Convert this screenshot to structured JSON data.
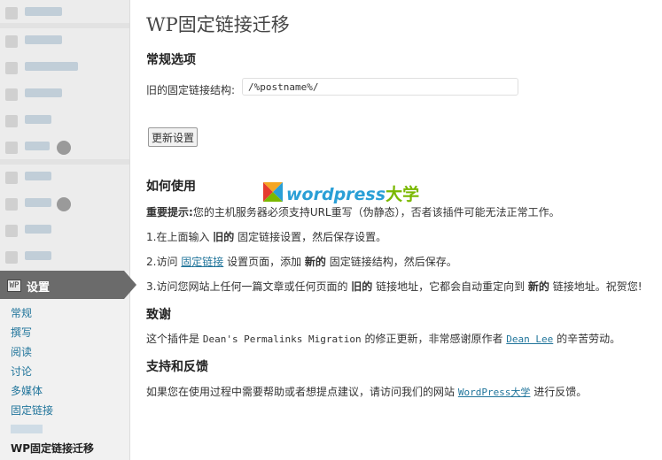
{
  "sidebar": {
    "settings_label": "设置",
    "settings_icon_text": "WP",
    "submenu": [
      "常规",
      "撰写",
      "阅读",
      "讨论",
      "多媒体",
      "固定链接",
      "WP固定链接迁移"
    ]
  },
  "page": {
    "title": "WP固定链接迁移",
    "general_heading": "常规选项",
    "old_structure_label": "旧的固定链接结构:",
    "old_structure_value": "/%postname%/",
    "update_button": "更新设置",
    "how_heading": "如何使用",
    "note_label": "重要提示:",
    "note_text": "您的主机服务器必须支持URL重写（伪静态），否者该插件可能无法正常工作。",
    "step1_a": "1.在上面输入 ",
    "step1_b": "旧的",
    "step1_c": " 固定链接设置，然后保存设置。",
    "step2_a": "2.访问 ",
    "step2_link": "固定链接",
    "step2_b": " 设置页面，添加 ",
    "step2_c": "新的",
    "step2_d": " 固定链接结构，然后保存。",
    "step3_a": "3.访问您网站上任何一篇文章或任何页面的 ",
    "step3_b": "旧的",
    "step3_c": " 链接地址，它都会自动重定向到 ",
    "step3_d": "新的",
    "step3_e": " 链接地址。祝贺您!",
    "thanks_heading": "致谢",
    "thanks_a": "这个插件是 ",
    "thanks_plugin": "Dean's Permalinks Migration",
    "thanks_b": " 的修正更新，非常感谢原作者 ",
    "thanks_author": "Dean Lee",
    "thanks_c": " 的辛苦劳动。",
    "support_heading": "支持和反馈",
    "support_a": "如果您在使用过程中需要帮助或者想提点建议，请访问我们的网站 ",
    "support_link": "WordPress大学",
    "support_b": " 进行反馈。"
  },
  "watermark": {
    "text": "wordpress",
    "text_cn": "大学"
  },
  "colors": {
    "link": "#21759b",
    "sidebar_active": "#6b6b6b",
    "watermark_blue": "#2a9fd6",
    "watermark_green": "#7ab800"
  }
}
